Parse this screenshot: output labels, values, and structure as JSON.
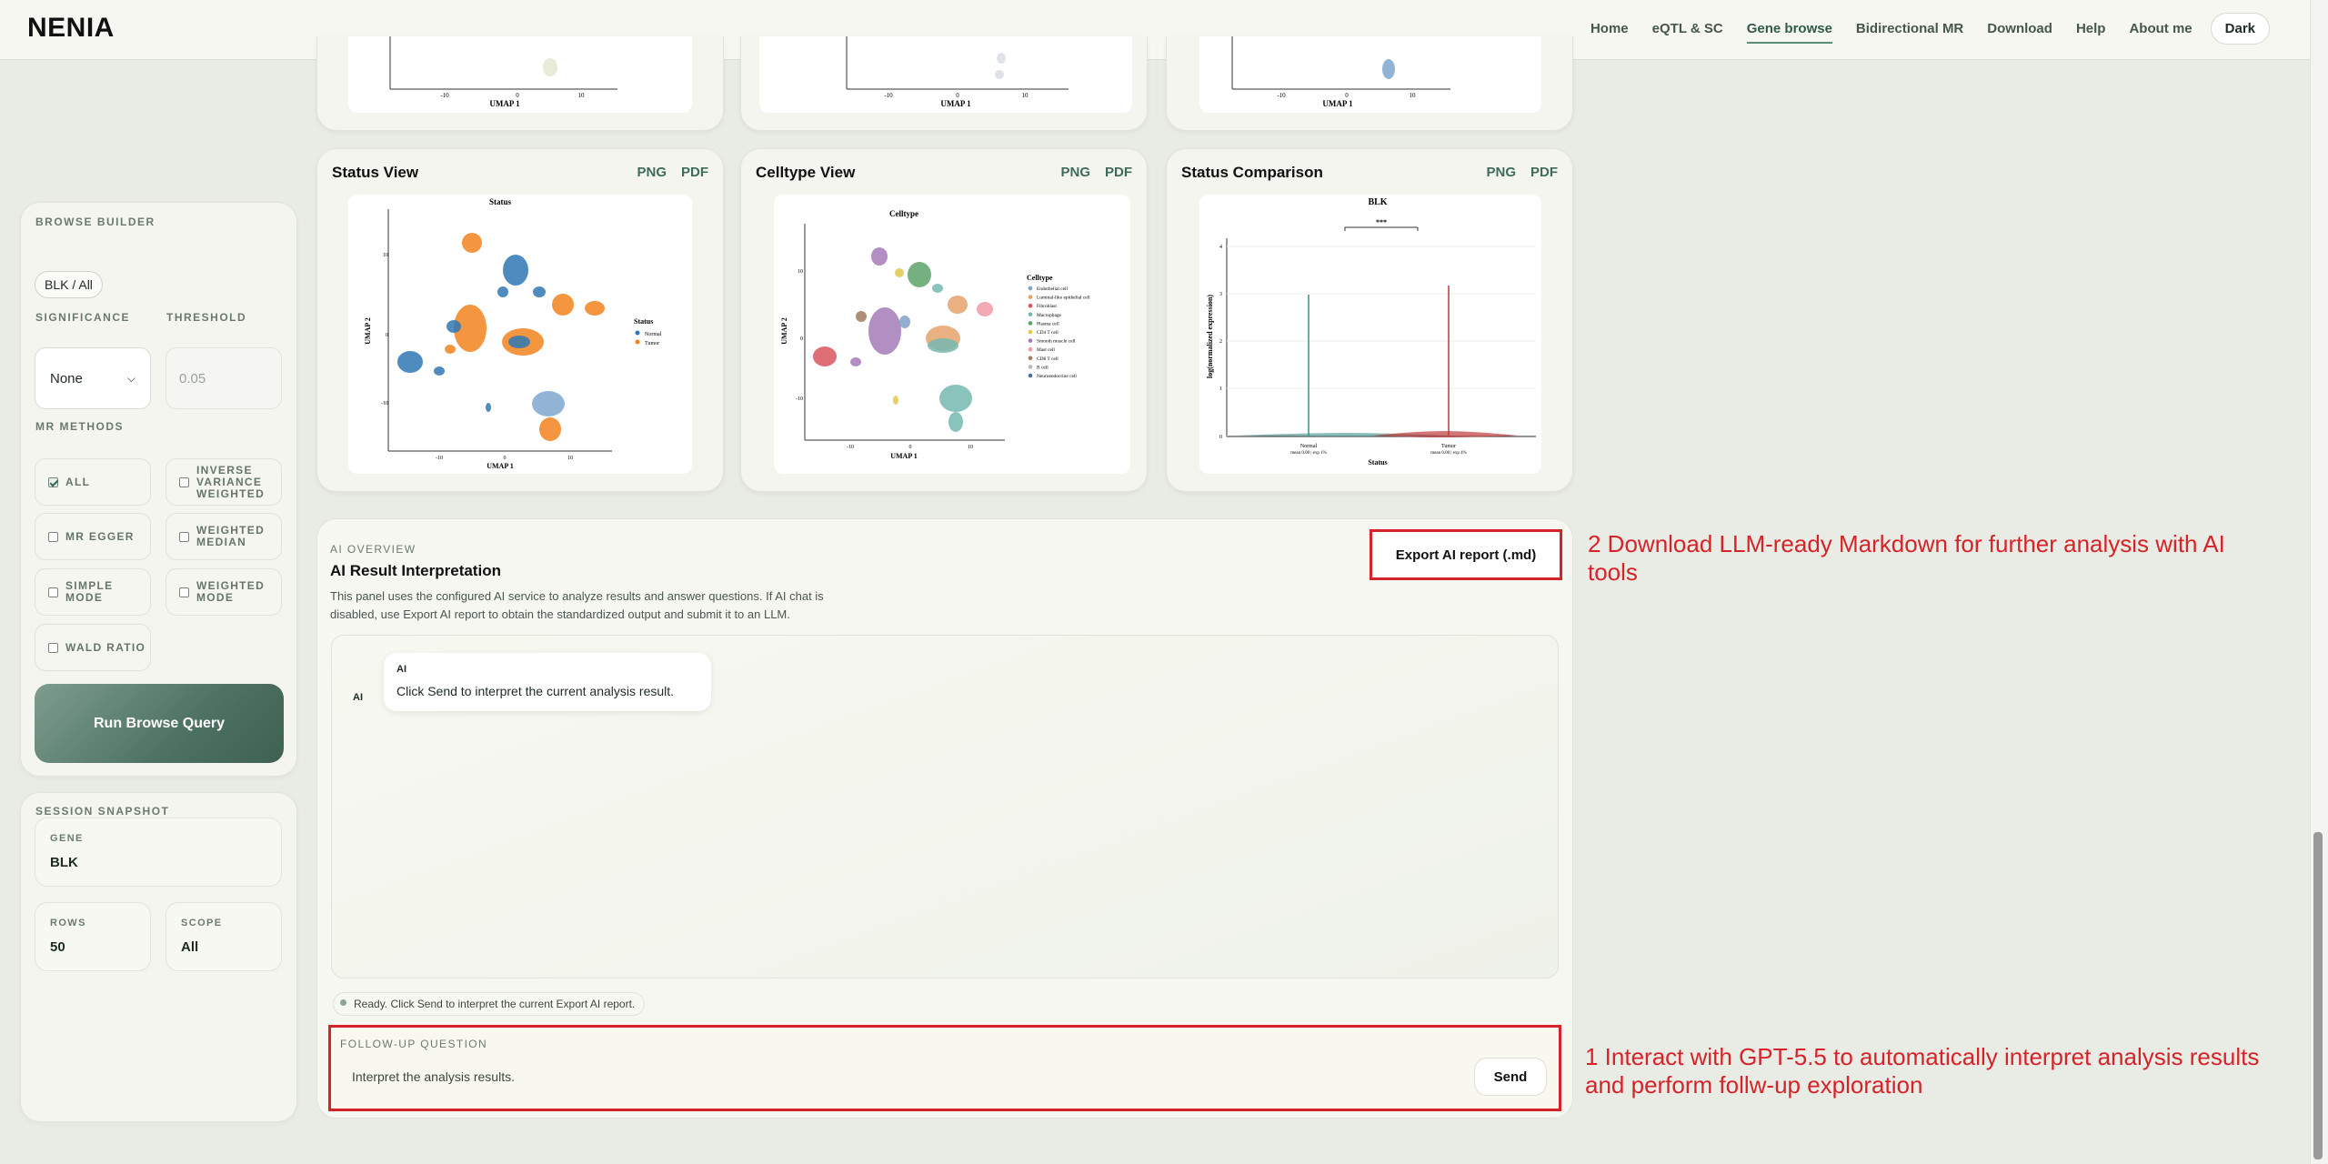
{
  "header": {
    "brand": "NENIA",
    "nav": [
      "Home",
      "eQTL & SC",
      "Gene browse",
      "Bidirectional MR",
      "Download",
      "Help",
      "About me"
    ],
    "active_nav": "Gene browse",
    "theme_button": "Dark"
  },
  "top_plots": {
    "axis_label": "UMAP 1",
    "ticks": [
      "-10",
      "0",
      "10"
    ]
  },
  "sidebar": {
    "builder": {
      "title": "BROWSE BUILDER",
      "chip": "BLK / All",
      "significance_label": "SIGNIFICANCE",
      "threshold_label": "THRESHOLD",
      "significance_value": "None",
      "threshold_placeholder": "0.05",
      "mr_methods_label": "MR METHODS",
      "methods": [
        {
          "label": "ALL",
          "checked": true
        },
        {
          "label": "INVERSE VARIANCE WEIGHTED",
          "checked": false
        },
        {
          "label": "MR EGGER",
          "checked": false
        },
        {
          "label": "WEIGHTED MEDIAN",
          "checked": false
        },
        {
          "label": "SIMPLE MODE",
          "checked": false
        },
        {
          "label": "WEIGHTED MODE",
          "checked": false
        },
        {
          "label": "WALD RATIO",
          "checked": false
        }
      ],
      "run_button": "Run Browse Query"
    },
    "snapshot": {
      "title": "SESSION SNAPSHOT",
      "gene_label": "GENE",
      "gene_value": "BLK",
      "rows_label": "ROWS",
      "rows_value": "50",
      "scope_label": "SCOPE",
      "scope_value": "All"
    }
  },
  "cards": [
    {
      "title": "Status View",
      "png": "PNG",
      "pdf": "PDF",
      "plot_title": "Status",
      "xlabel": "UMAP 1",
      "ylabel": "UMAP 2",
      "x_ticks": [
        "-10",
        "0",
        "10"
      ],
      "y_ticks": [
        "10",
        "0",
        "-10"
      ],
      "legend_title": "Status",
      "legend": [
        {
          "name": "Normal",
          "color": "#2f78b4"
        },
        {
          "name": "Tumor",
          "color": "#f2821f"
        }
      ]
    },
    {
      "title": "Celltype View",
      "png": "PNG",
      "pdf": "PDF",
      "plot_title": "Celltype",
      "xlabel": "UMAP 1",
      "ylabel": "UMAP 2",
      "x_ticks": [
        "-10",
        "0",
        "10"
      ],
      "y_ticks": [
        "10",
        "0",
        "-10"
      ],
      "legend_title": "Celltype",
      "legend": [
        {
          "name": "Endothelial cell",
          "color": "#7fa2c6"
        },
        {
          "name": "Luminal-like epithelial cell",
          "color": "#e5a36b"
        },
        {
          "name": "Fibroblast",
          "color": "#d9555e"
        },
        {
          "name": "Macrophage",
          "color": "#76b8b0"
        },
        {
          "name": "Plasma cell",
          "color": "#5da36a"
        },
        {
          "name": "CD4 T cell",
          "color": "#e3c74d"
        },
        {
          "name": "Smooth muscle cell",
          "color": "#a37bb8"
        },
        {
          "name": "Mast cell",
          "color": "#f19aa5"
        },
        {
          "name": "CD8 T cell",
          "color": "#a07c62"
        },
        {
          "name": "B cell",
          "color": "#b8b8b8"
        },
        {
          "name": "Neuroendocrine cell",
          "color": "#4d6fa8"
        }
      ]
    },
    {
      "title": "Status Comparison",
      "png": "PNG",
      "pdf": "PDF",
      "plot_title": "BLK",
      "xlabel": "Status",
      "ylabel": "log(normalized expression)",
      "significance": "***",
      "groups": [
        {
          "name": "Normal",
          "note": "mean 0.00 | exp 1%",
          "color": "#3f8f8a"
        },
        {
          "name": "Tumor",
          "note": "mean 0.00 | exp 4%",
          "color": "#c0393b"
        }
      ],
      "y_ticks": [
        "4",
        "3",
        "2",
        "1",
        "0"
      ]
    }
  ],
  "ai": {
    "overview_label": "AI OVERVIEW",
    "title": "AI Result Interpretation",
    "description": "This panel uses the configured AI service to analyze results and answer questions. If AI chat is disabled, use Export AI report to obtain the standardized output and submit it to an LLM.",
    "export_button": "Export AI report (.md)",
    "avatar": "AI",
    "bubble_sender": "AI",
    "bubble_text": "Click Send to interpret the current analysis result.",
    "status_text": "Ready. Click Send to interpret the current Export AI report.",
    "followup_label": "FOLLOW-UP QUESTION",
    "followup_value": "Interpret the analysis results.",
    "send_button": "Send"
  },
  "annotations": {
    "note2": "2 Download LLM-ready Markdown for further analysis with AI tools",
    "note1": "1 Interact with GPT-5.5 to automatically interpret analysis results and perform follw-up exploration"
  },
  "colors": {
    "accent": "#3f6b5b",
    "annotation_red": "#d6232a"
  }
}
